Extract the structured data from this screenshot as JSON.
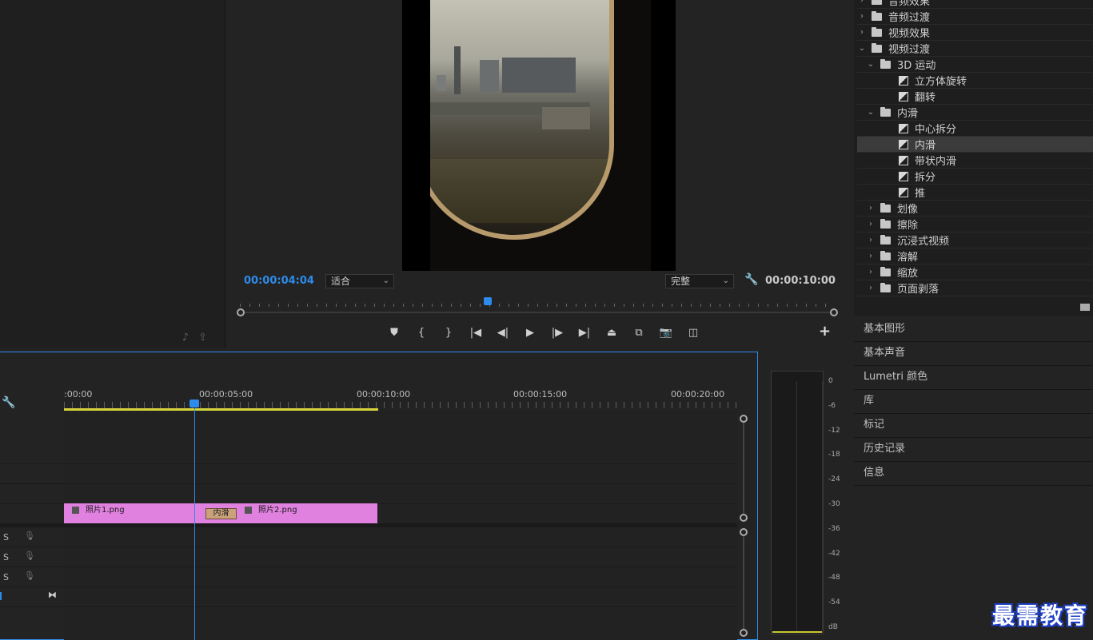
{
  "program_monitor": {
    "current_timecode": "00:00:04:04",
    "fit_dropdown": "适合",
    "quality_dropdown": "完整",
    "duration": "00:00:10:00",
    "playhead_fraction": 0.416
  },
  "effects_tree": [
    {
      "label": "音频效果",
      "type": "folder",
      "depth": 0,
      "expanded": false
    },
    {
      "label": "音频过渡",
      "type": "folder",
      "depth": 0,
      "expanded": false
    },
    {
      "label": "视频效果",
      "type": "folder",
      "depth": 0,
      "expanded": false
    },
    {
      "label": "视频过渡",
      "type": "folder",
      "depth": 0,
      "expanded": true
    },
    {
      "label": "3D 运动",
      "type": "folder",
      "depth": 1,
      "expanded": true
    },
    {
      "label": "立方体旋转",
      "type": "preset",
      "depth": 2
    },
    {
      "label": "翻转",
      "type": "preset",
      "depth": 2
    },
    {
      "label": "内滑",
      "type": "folder",
      "depth": 1,
      "expanded": true
    },
    {
      "label": "中心拆分",
      "type": "preset",
      "depth": 2
    },
    {
      "label": "内滑",
      "type": "preset",
      "depth": 2,
      "selected": true
    },
    {
      "label": "带状内滑",
      "type": "preset",
      "depth": 2
    },
    {
      "label": "拆分",
      "type": "preset",
      "depth": 2
    },
    {
      "label": "推",
      "type": "preset",
      "depth": 2
    },
    {
      "label": "划像",
      "type": "folder",
      "depth": 1,
      "expanded": false
    },
    {
      "label": "擦除",
      "type": "folder",
      "depth": 1,
      "expanded": false
    },
    {
      "label": "沉浸式视频",
      "type": "folder",
      "depth": 1,
      "expanded": false
    },
    {
      "label": "溶解",
      "type": "folder",
      "depth": 1,
      "expanded": false
    },
    {
      "label": "缩放",
      "type": "folder",
      "depth": 1,
      "expanded": false
    },
    {
      "label": "页面剥落",
      "type": "folder",
      "depth": 1,
      "expanded": false
    }
  ],
  "side_panels": [
    "基本图形",
    "基本声音",
    "Lumetri 颜色",
    "库",
    "标记",
    "历史记录",
    "信息"
  ],
  "timeline": {
    "ruler_labels": [
      ":00:00",
      "00:00:05:00",
      "00:00:10:00",
      "00:00:15:00",
      "00:00:20:00"
    ],
    "clip1": "照片1.png",
    "clip2": "照片2.png",
    "transition": "内滑",
    "audio_track_solo": "S"
  },
  "audio_meter": {
    "db_labels": [
      "0",
      "-6",
      "-12",
      "-18",
      "-24",
      "-30",
      "-36",
      "-42",
      "-48",
      "-54",
      "dB"
    ]
  },
  "watermark": "最需教育",
  "colors": {
    "accent": "#2d8ceb",
    "clip": "#e081e0",
    "transition": "#c9a27c",
    "work_area": "#d6d63a"
  }
}
